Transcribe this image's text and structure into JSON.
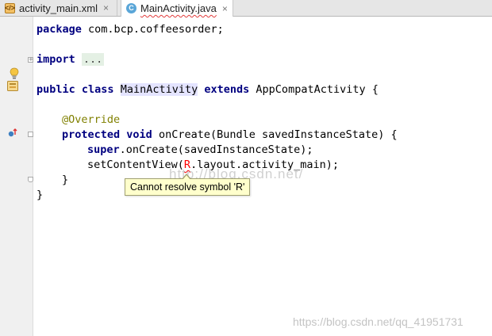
{
  "tabs": [
    {
      "label": "activity_main.xml",
      "icon": "xml-file-icon",
      "close": "×",
      "active": false
    },
    {
      "label": "MainActivity.java",
      "icon": "java-class-icon",
      "close": "×",
      "active": true
    }
  ],
  "code": {
    "line1": {
      "kw": "package",
      "rest": " com.bcp.coffeesorder;"
    },
    "line2": {
      "kw": "import",
      "folded": "..."
    },
    "line3": {
      "kw1": "public",
      "kw2": "class",
      "name": "MainActivity",
      "kw3": "extends",
      "rest": " AppCompatActivity {"
    },
    "line4": {
      "annotation": "@Override"
    },
    "line5": {
      "kw1": "protected",
      "kw2": "void",
      "rest": " onCreate(Bundle savedInstanceState) {"
    },
    "line6": {
      "kw": "super",
      "rest": ".onCreate(savedInstanceState);"
    },
    "line7": {
      "pre": "setContentView(",
      "error_symbol": "R",
      "post": ".layout.activity_main);"
    },
    "line8": {
      "text": "}"
    },
    "line9": {
      "text": "}"
    }
  },
  "tooltip": {
    "text": "Cannot resolve symbol 'R'"
  },
  "watermarks": {
    "center": "http://blog.csdn.net/",
    "corner": "https://blog.csdn.net/qq_41951731"
  },
  "colors": {
    "keyword": "#000080",
    "annotation": "#808000",
    "error": "#ff0000",
    "tooltip_bg": "#ffffcc"
  }
}
